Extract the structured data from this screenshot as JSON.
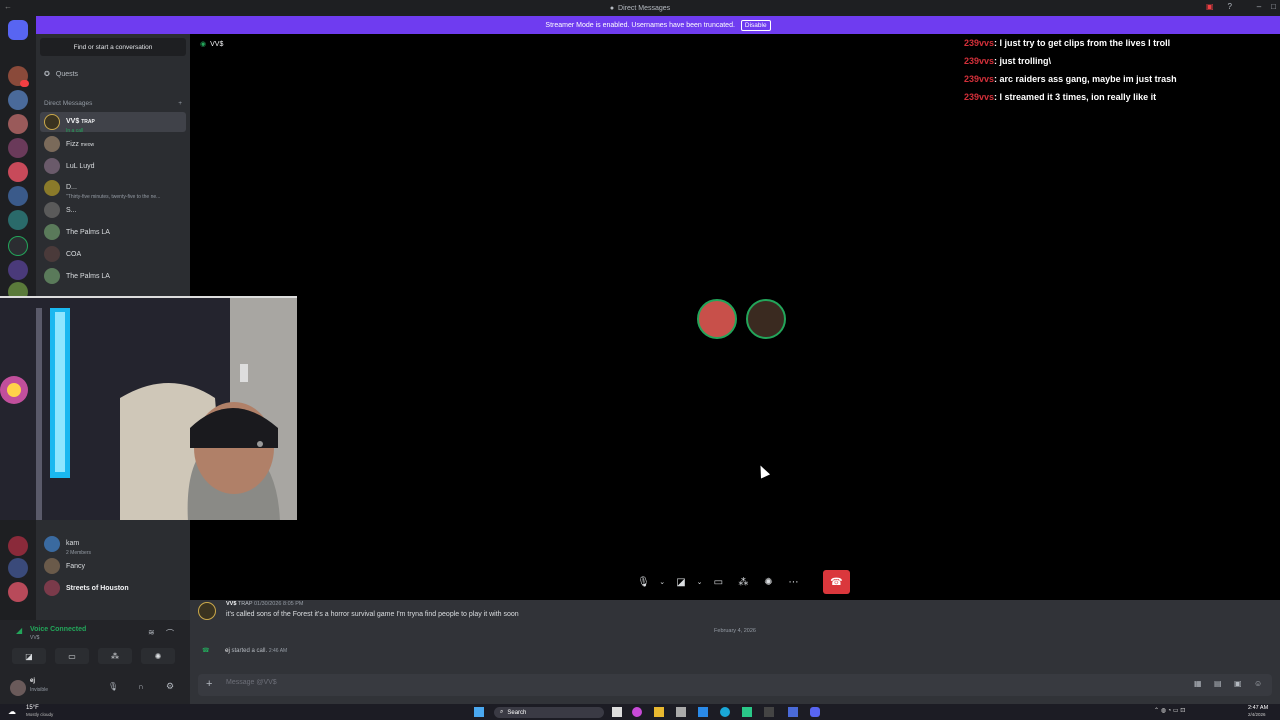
{
  "titlebar": {
    "title": "Direct Messages"
  },
  "banner": {
    "text": "Streamer Mode is enabled. Usernames have been truncated.",
    "disable_label": "Disable"
  },
  "sidebar": {
    "find_label": "Find or start a conversation",
    "quests_label": "Quests",
    "dm_header": "Direct Messages",
    "dms": [
      {
        "name": "VV$",
        "tag": "TRAP",
        "status": "In a call"
      },
      {
        "name": "Fizz",
        "tag": "meow"
      },
      {
        "name": "LuL Luyd"
      },
      {
        "name": "D...",
        "status": "\"Thirty-five minutes, twenty-five to the ne..."
      },
      {
        "name": "S..."
      },
      {
        "name": "The Palms LA"
      },
      {
        "name": "COA"
      },
      {
        "name": "The Palms LA"
      },
      {
        "name": "kam",
        "status": "2 Members"
      },
      {
        "name": "Fancy"
      },
      {
        "name": "Streets of Houston"
      }
    ]
  },
  "voice": {
    "label": "Voice Connected",
    "channel": "VV$"
  },
  "user": {
    "name": "ej",
    "status": "Invisible"
  },
  "channel": {
    "name": "VV$"
  },
  "stream_chat": [
    {
      "user": "239vvs",
      "text": ": I just try to get clips from the lives I troll"
    },
    {
      "user": "239vvs",
      "text": ": just trolling\\"
    },
    {
      "user": "239vvs",
      "text": ": arc raiders ass gang, maybe im just trash"
    },
    {
      "user": "239vvs",
      "text": ": I streamed it 3 times, ion really like it"
    }
  ],
  "messages": {
    "author": "VV$",
    "author_tag": "TRAP",
    "time": "01/30/2026 8:05 PM",
    "text": "it's called sons of the Forest it's a horror survival game I'm tryna find people to play it with soon",
    "date_divider": "February 4, 2026",
    "call_author": "ej",
    "call_text": "started a call.",
    "call_time": "2:46 AM",
    "composer_placeholder": "Message @VV$"
  },
  "taskbar": {
    "weather": "15°F",
    "weather_sub": "Mostly cloudy",
    "search": "Search",
    "time": "2:47 AM",
    "date": "2/4/2026"
  },
  "colors": {
    "accent": "#5865f2",
    "banner": "#6f3cf0",
    "voice_green": "#23a55a",
    "end_call": "#da373c",
    "chat_user": "#d4303a"
  }
}
